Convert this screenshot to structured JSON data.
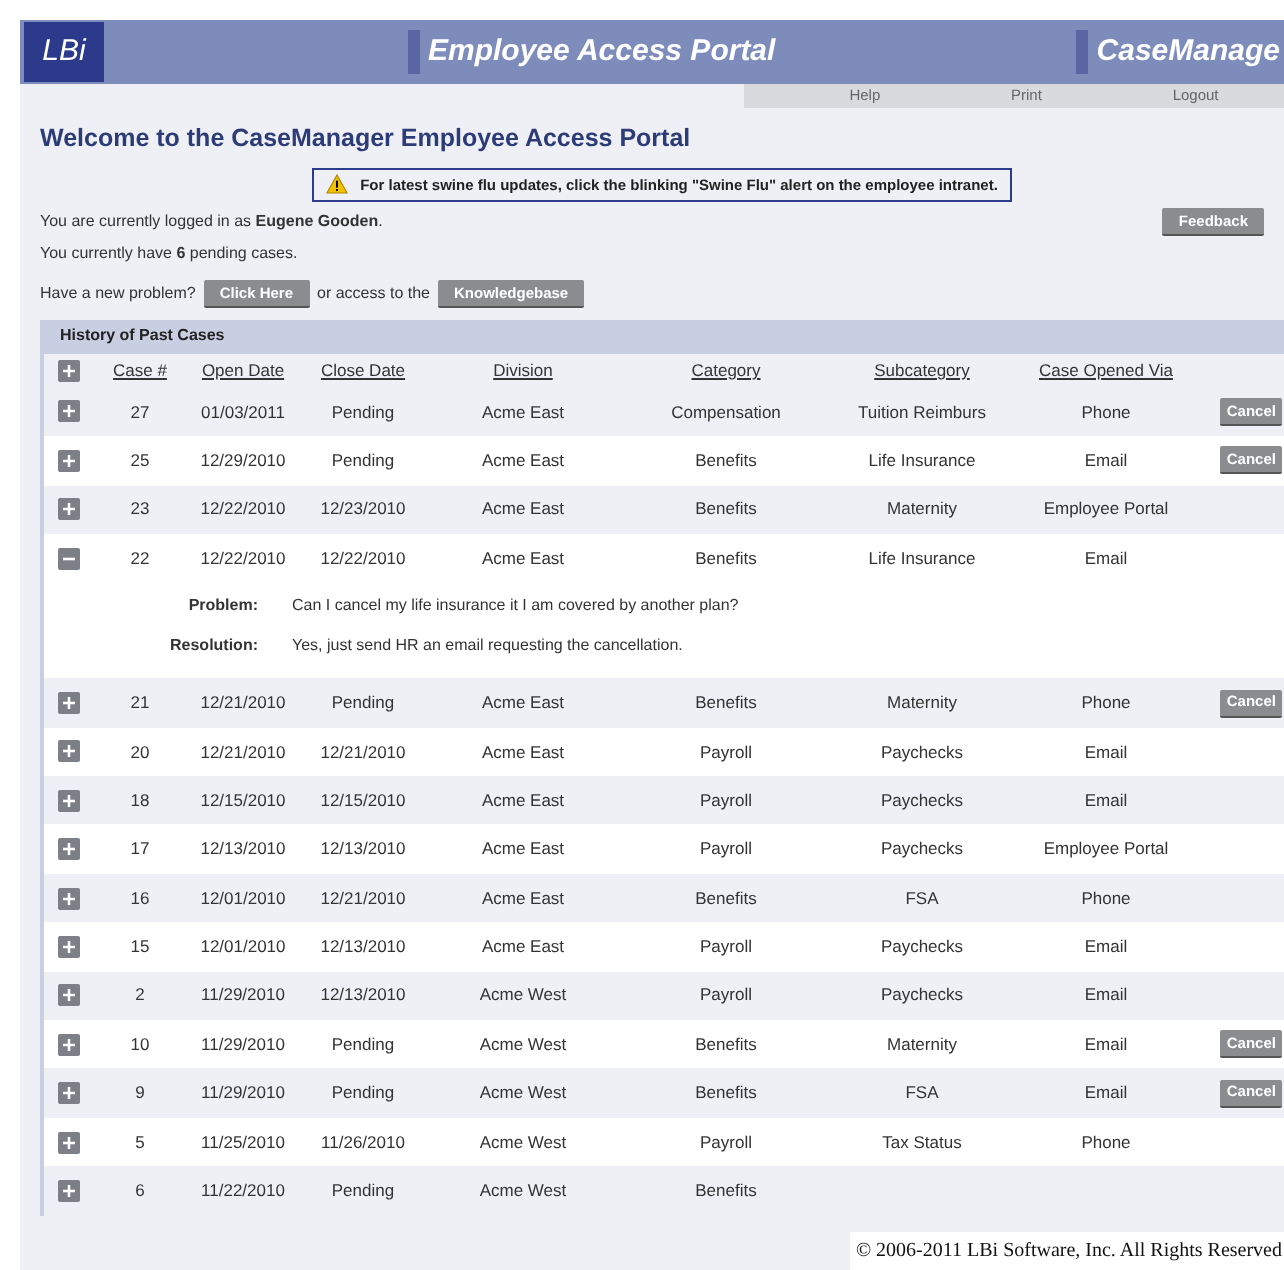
{
  "header": {
    "logo": "LBi",
    "title": "Employee Access Portal",
    "product": "CaseManage"
  },
  "nav": [
    "Help",
    "Print",
    "Logout"
  ],
  "welcome": "Welcome to the CaseManager Employee Access Portal",
  "alert": "For latest swine flu updates, click the blinking \"Swine Flu\" alert on the employee intranet.",
  "logged_in": "You are currently logged in as **Eugene Gooden**.",
  "feedback_button": "Feedback",
  "pending": "You currently have **6** pending cases.",
  "new_problem": {
    "before": "Have a new problem?",
    "button": "Click Here",
    "middle": "or access to the",
    "link_button": "Knowledgebase"
  },
  "table": {
    "title": "History of Past Cases",
    "columns": [
      "Case #",
      "Open Date",
      "Close Date",
      "Division",
      "Category",
      "Subcategory",
      "Case Opened Via"
    ],
    "rows": [
      {
        "case": "27",
        "open_date": "01/03/2011",
        "close_date": "Pending",
        "division": "Acme East",
        "category": "Compensation",
        "subcategory": "Tuition Reimburs",
        "via": "Phone",
        "cancel": "Cancel",
        "expanded": false
      },
      {
        "case": "25",
        "open_date": "12/29/2010",
        "close_date": "Pending",
        "division": "Acme East",
        "category": "Benefits",
        "subcategory": "Life Insurance",
        "via": "Email",
        "cancel": "Cancel",
        "expanded": false
      },
      {
        "case": "23",
        "open_date": "12/22/2010",
        "close_date": "12/23/2010",
        "division": "Acme East",
        "category": "Benefits",
        "subcategory": "Maternity",
        "via": "Employee Portal",
        "expanded": false
      },
      {
        "case": "22",
        "open_date": "12/22/2010",
        "close_date": "12/22/2010",
        "division": "Acme East",
        "category": "Benefits",
        "subcategory": "Life Insurance",
        "via": "Email",
        "expanded": true,
        "details": [
          {
            "label": "Problem:",
            "text": "Can I cancel my life insurance it I am covered by another plan?"
          },
          {
            "label": "Resolution:",
            "text": "Yes, just send HR an email requesting the cancellation."
          }
        ]
      },
      {
        "case": "21",
        "open_date": "12/21/2010",
        "close_date": "Pending",
        "division": "Acme East",
        "category": "Benefits",
        "subcategory": "Maternity",
        "via": "Phone",
        "cancel": "Cancel",
        "expanded": false
      },
      {
        "case": "20",
        "open_date": "12/21/2010",
        "close_date": "12/21/2010",
        "division": "Acme East",
        "category": "Payroll",
        "subcategory": "Paychecks",
        "via": "Email",
        "expanded": false
      },
      {
        "case": "18",
        "open_date": "12/15/2010",
        "close_date": "12/15/2010",
        "division": "Acme East",
        "category": "Payroll",
        "subcategory": "Paychecks",
        "via": "Email",
        "expanded": false
      },
      {
        "case": "17",
        "open_date": "12/13/2010",
        "close_date": "12/13/2010",
        "division": "Acme East",
        "category": "Payroll",
        "subcategory": "Paychecks",
        "via": "Employee Portal",
        "expanded": false
      },
      {
        "case": "16",
        "open_date": "12/01/2010",
        "close_date": "12/21/2010",
        "division": "Acme East",
        "category": "Benefits",
        "subcategory": "FSA",
        "via": "Phone",
        "expanded": false
      },
      {
        "case": "15",
        "open_date": "12/01/2010",
        "close_date": "12/13/2010",
        "division": "Acme East",
        "category": "Payroll",
        "subcategory": "Paychecks",
        "via": "Email",
        "expanded": false
      },
      {
        "case": "2",
        "open_date": "11/29/2010",
        "close_date": "12/13/2010",
        "division": "Acme West",
        "category": "Payroll",
        "subcategory": "Paychecks",
        "via": "Email",
        "expanded": false
      },
      {
        "case": "10",
        "open_date": "11/29/2010",
        "close_date": "Pending",
        "division": "Acme West",
        "category": "Benefits",
        "subcategory": "Maternity",
        "via": "Email",
        "cancel": "Cancel",
        "expanded": false
      },
      {
        "case": "9",
        "open_date": "11/29/2010",
        "close_date": "Pending",
        "division": "Acme West",
        "category": "Benefits",
        "subcategory": "FSA",
        "via": "Email",
        "cancel": "Cancel",
        "expanded": false
      },
      {
        "case": "5",
        "open_date": "11/25/2010",
        "close_date": "11/26/2010",
        "division": "Acme West",
        "category": "Payroll",
        "subcategory": "Tax Status",
        "via": "Phone",
        "expanded": false
      },
      {
        "case": "6",
        "open_date": "11/22/2010",
        "close_date": "Pending",
        "division": "Acme West",
        "category": "Benefits",
        "expanded": false
      }
    ]
  },
  "copyright": "© 2006-2011 LBi Software, Inc. All Rights Reserved"
}
